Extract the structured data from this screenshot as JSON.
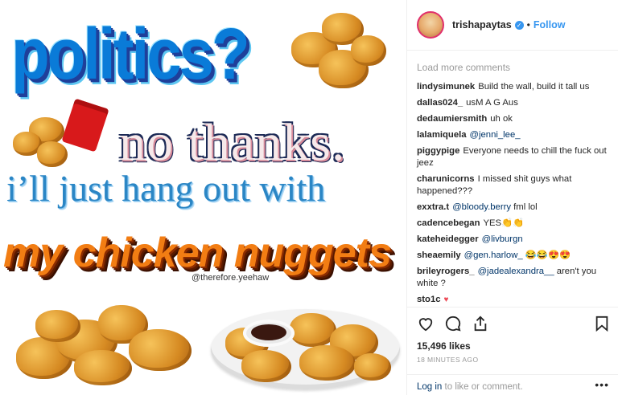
{
  "image": {
    "headline": "politics?",
    "line2": "no thanks.",
    "line3": "i’ll just hang out with",
    "line4": "my chicken nuggets",
    "handle": "@therefore.yeehaw"
  },
  "header": {
    "username": "trishapaytas",
    "verified_glyph": "✓",
    "separator": "•",
    "follow_label": "Follow"
  },
  "comments": {
    "load_more": "Load more comments",
    "items": [
      {
        "user": "lindysimunek",
        "text": "Build the wall, build it tall us"
      },
      {
        "user": "dallas024_",
        "text": "usM A G Aus"
      },
      {
        "user": "dedaumiersmith",
        "text": "uh ok"
      },
      {
        "user": "lalamiquela",
        "mention": "@jenni_lee_",
        "text": ""
      },
      {
        "user": "piggypige",
        "text": "Everyone needs to chill the fuck out jeez"
      },
      {
        "user": "charunicorns",
        "text": "I missed shit guys what happened???"
      },
      {
        "user": "exxtra.t",
        "mention": "@bloody.berry",
        "text": "fml lol"
      },
      {
        "user": "cadencebegan",
        "text": "YES👏👏"
      },
      {
        "user": "kateheidegger",
        "mention": "@livburgn",
        "text": ""
      },
      {
        "user": "sheaemily",
        "mention": "@gen.harlow_",
        "text": "😂😂😍😍"
      },
      {
        "user": "brileyrogers_",
        "mention": "@jadealexandra__",
        "text": "aren't you white ?"
      },
      {
        "user": "sto1c",
        "text": "♥"
      }
    ]
  },
  "actions": {
    "like_icon": "heart-icon",
    "comment_icon": "comment-icon",
    "share_icon": "share-icon",
    "save_icon": "bookmark-icon"
  },
  "stats": {
    "likes": "15,496 likes",
    "time": "18 MINUTES AGO"
  },
  "footer": {
    "login": "Log in",
    "rest": " to like or comment.",
    "more": "•••"
  },
  "colors": {
    "accent": "#3897f0",
    "heart": "#ed4956",
    "mention": "#003569"
  }
}
